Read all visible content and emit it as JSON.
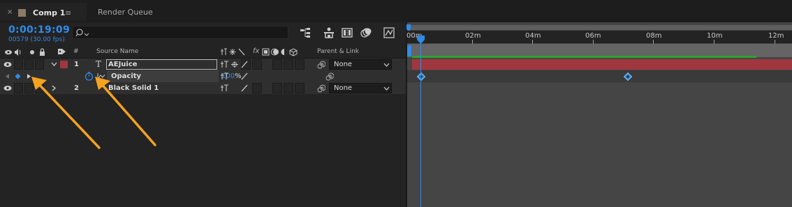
{
  "tabs": {
    "close_glyph": "×",
    "comp_label": "Comp 1",
    "menu_glyph": "≡",
    "render_label": "Render Queue"
  },
  "header": {
    "timecode": "0:00:19:09",
    "frame_info": "00579 (30.00 fps)",
    "search_placeholder": ""
  },
  "columns": {
    "number": "#",
    "source_name": "Source Name",
    "parent_link": "Parent & Link",
    "fx": "fx"
  },
  "layers": [
    {
      "number": "1",
      "type_glyph": "T",
      "name": "AEJuice",
      "parent": "None",
      "label_color": "#a0373f"
    },
    {
      "number": "2",
      "type_glyph": "",
      "name": "Black Solid 1",
      "parent": "None",
      "label_color": "#2f2f2f"
    }
  ],
  "property": {
    "name": "Opacity",
    "value": "100",
    "unit": "%"
  },
  "ruler": {
    "labels": [
      "00m",
      "02m",
      "04m",
      "06m",
      "08m",
      "10m",
      "12m"
    ]
  },
  "colors": {
    "accent": "#2d8ceb",
    "layer_bar": "#a0373f",
    "arrow": "#f5a21f",
    "work_area_green": "#2fa32f"
  }
}
